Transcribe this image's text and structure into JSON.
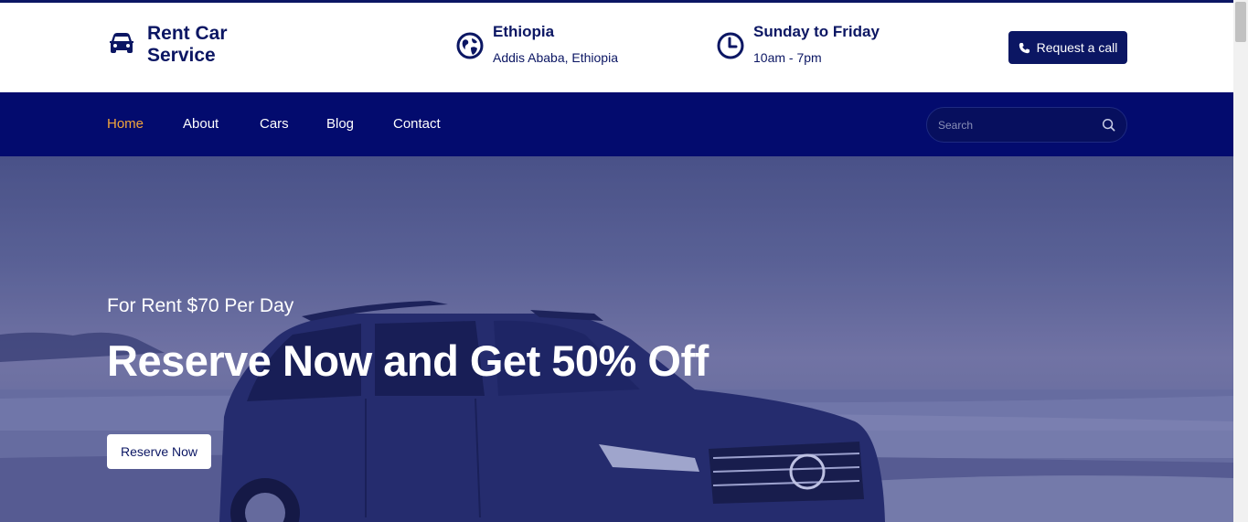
{
  "header": {
    "logo_line1": "Rent Car",
    "logo_line2": "Service",
    "logo_icon": "car-icon",
    "location": {
      "title": "Ethiopia",
      "subtitle": "Addis Ababa, Ethiopia",
      "icon": "globe-icon"
    },
    "hours": {
      "title": "Sunday to Friday",
      "subtitle": "10am - 7pm",
      "icon": "clock-icon"
    },
    "call_button": {
      "label": "Request a call",
      "icon": "phone-icon"
    }
  },
  "nav": {
    "items": [
      {
        "label": "Home",
        "active": true
      },
      {
        "label": "About",
        "active": false
      },
      {
        "label": "Cars",
        "active": false
      },
      {
        "label": "Blog",
        "active": false
      },
      {
        "label": "Contact",
        "active": false
      }
    ],
    "search": {
      "placeholder": "Search",
      "value": "",
      "icon": "search-icon"
    }
  },
  "hero": {
    "subtitle": "For Rent $70 Per Day",
    "title": "Reserve Now and Get 50% Off",
    "button_label": "Reserve Now"
  },
  "colors": {
    "brand": "#0b1663",
    "nav_bg": "#030b6e",
    "active_nav": "#f3a63b",
    "white": "#ffffff"
  }
}
